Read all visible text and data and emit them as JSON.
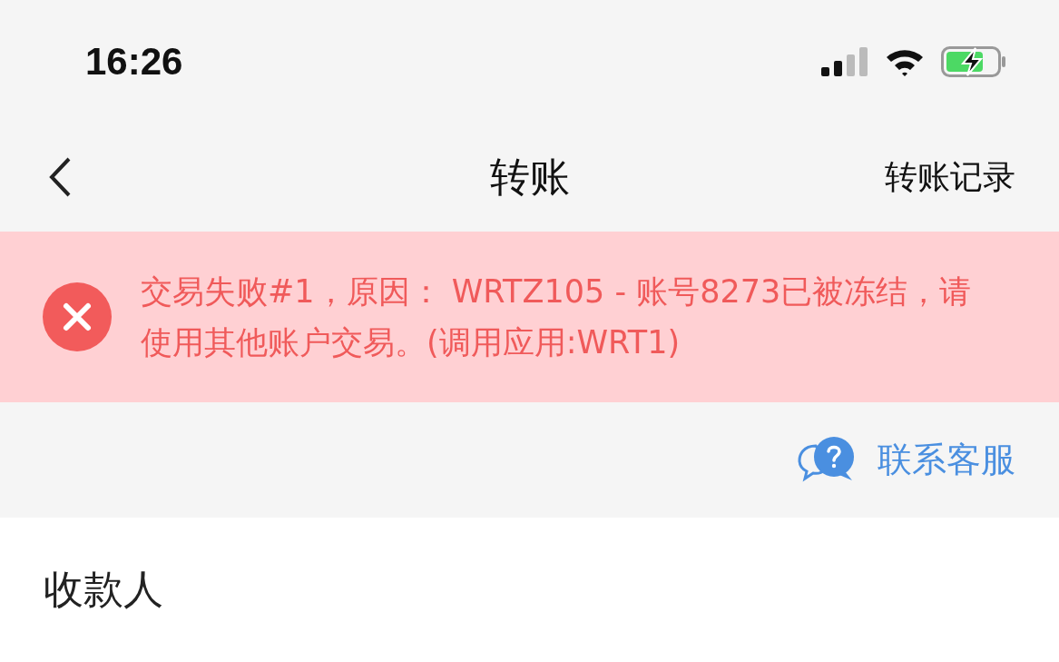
{
  "status_bar": {
    "time": "16:26"
  },
  "nav": {
    "title": "转账",
    "action": "转账记录"
  },
  "error_banner": {
    "message": "交易失败#1，原因： WRTZ105 - 账号8273已被冻结，请使用其他账户交易。(调用应用:WRT1)"
  },
  "support_link": {
    "label": "联系客服"
  },
  "section": {
    "title": "收款人"
  }
}
